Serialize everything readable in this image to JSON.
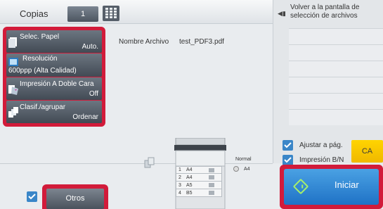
{
  "header": {
    "copies_label": "Copias",
    "copies_value": "1"
  },
  "settings": [
    {
      "label": "Selec. Papel",
      "value": "Auto."
    },
    {
      "label": "Resolución",
      "value": "600ppp (Alta Calidad)"
    },
    {
      "label": "Impresión A Doble Cara",
      "value": "Off"
    },
    {
      "label": "Clasif./agrupar",
      "value": "Ordenar"
    }
  ],
  "file": {
    "label": "Nombre Archivo",
    "value": "test_PDF3.pdf"
  },
  "right_panel": {
    "back_label": "Volver a la pantalla de selección de archivos"
  },
  "options": {
    "fit_page": "Ajustar a pág.",
    "bw_print": "Impresión B/N"
  },
  "buttons": {
    "ca": "CA",
    "start": "Iniciar",
    "others": "Otros"
  },
  "trays": [
    {
      "n": "1",
      "size": "A4"
    },
    {
      "n": "2",
      "size": "A4"
    },
    {
      "n": "3",
      "size": "A5"
    },
    {
      "n": "4",
      "size": "B5"
    }
  ],
  "bypass": {
    "type": "Normal",
    "size": "A4"
  },
  "colors": {
    "highlight": "#d21b3a",
    "start": "#1f72c6",
    "ca": "#f0b800",
    "checkbox": "#3a86c8"
  }
}
